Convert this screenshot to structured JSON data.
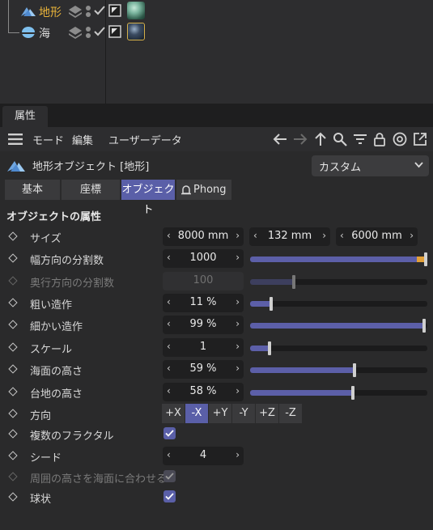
{
  "object_manager": {
    "objects": [
      {
        "name": "地形",
        "selected": true,
        "icon": "terrain-icon",
        "name_color": "#e8b33a"
      },
      {
        "name": "海",
        "selected": false,
        "icon": "sphere-icon",
        "name_color": "#d8d8d8"
      }
    ]
  },
  "attributes": {
    "panel_tab": "属性",
    "menu": {
      "mode": "モード",
      "edit": "編集",
      "userdata": "ユーザーデータ"
    },
    "toolbar_icons": [
      "back-arrow-icon",
      "forward-arrow-icon",
      "up-arrow-icon",
      "search-icon",
      "filter-icon",
      "lock-icon",
      "target-icon",
      "new-window-icon"
    ],
    "object_title": "地形オブジェクト [地形]",
    "preset": "カスタム",
    "tabs": [
      {
        "label": "基本",
        "active": false
      },
      {
        "label": "座標",
        "active": false
      },
      {
        "label": "オブジェクト",
        "active": true
      },
      {
        "label": "Phong",
        "active": false
      }
    ],
    "group_title": "オブジェクトの属性",
    "params": {
      "size": {
        "label": "サイズ",
        "x": "8000 mm",
        "y": "132 mm",
        "z": "6000 mm"
      },
      "width_segments": {
        "label": "幅方向の分割数",
        "value": "1000",
        "slider": 1.0
      },
      "depth_segments": {
        "label": "奥行方向の分割数",
        "value": "100",
        "slider": 0.24,
        "disabled": true
      },
      "rough_wrinkle": {
        "label": "粗い造作",
        "value": "11 %",
        "slider": 0.11
      },
      "fine_wrinkle": {
        "label": "細かい造作",
        "value": "99 %",
        "slider": 0.99
      },
      "scale": {
        "label": "スケール",
        "value": "1",
        "slider": 0.1
      },
      "sea_level": {
        "label": "海面の高さ",
        "value": "59 %",
        "slider": 0.59
      },
      "plateau_level": {
        "label": "台地の高さ",
        "value": "58 %",
        "slider": 0.58
      },
      "orientation": {
        "label": "方向",
        "options": [
          "+X",
          "-X",
          "+Y",
          "-Y",
          "+Z",
          "-Z"
        ],
        "selected": "-X"
      },
      "multifractal": {
        "label": "複数のフラクタル",
        "checked": true
      },
      "seed": {
        "label": "シード",
        "value": "4"
      },
      "limit_to_sea": {
        "label": "周囲の高さを海面に合わせる",
        "checked": true,
        "disabled": true
      },
      "spherical": {
        "label": "球状",
        "checked": true
      }
    }
  },
  "colors": {
    "accent": "#5a5fa8",
    "selected_name": "#e8b33a",
    "slider_max": "#e2a03a"
  }
}
